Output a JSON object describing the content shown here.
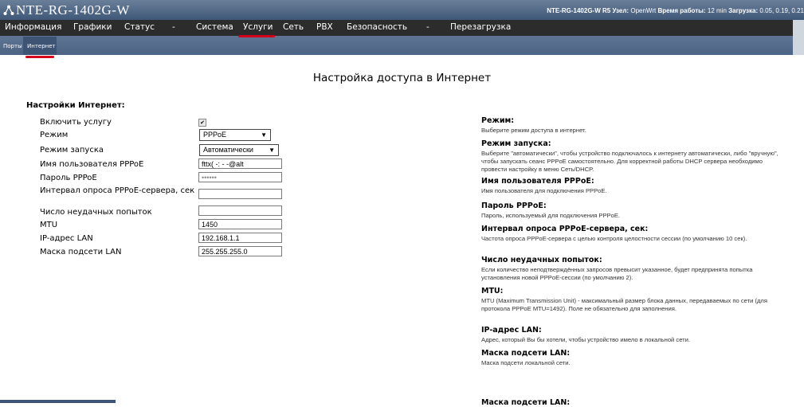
{
  "header": {
    "app_title": "NTE-RG-1402G-W",
    "status_model": "NTE-RG-1402G-W R5",
    "status_node_label": "Узел:",
    "status_node": "OpenWrt",
    "status_uptime_label": "Время работы:",
    "status_uptime": "12 min",
    "status_load_label": "Загрузка:",
    "status_load": "0.05, 0.19, 0.21"
  },
  "menu": {
    "items": [
      "Информация",
      "Графики",
      "Статус",
      "-",
      "Система",
      "Услуги",
      "Сеть",
      "PBX",
      "Безопасность",
      "-",
      "Перезагрузка"
    ],
    "active": "Услуги"
  },
  "submenu": {
    "items": [
      "Порты",
      "Интернет"
    ],
    "active": "Интернет"
  },
  "page": {
    "title": "Настройка доступа в Интернет",
    "section_title": "Настройки Интернет:"
  },
  "form": {
    "enable_label": "Включить услугу",
    "enable_checked": true,
    "mode_label": "Режим",
    "mode_value": "PPPoE",
    "start_label": "Режим запуска",
    "start_value": "Автоматически",
    "username_label": "Имя пользователя PPPoE",
    "username_value": "fttx(      -:      -      -@alt",
    "password_label": "Пароль PPPoE",
    "password_value": "••••••",
    "interval_label": "Интервал опроса PPPoE-сервера, сек",
    "interval_value": "",
    "failures_label": "Число неудачных попыток",
    "failures_value": "",
    "mtu_label": "MTU",
    "mtu_value": "1450",
    "ip_label": "IP-адрес LAN",
    "ip_value": "192.168.1.1",
    "mask_label": "Маска подсети LAN",
    "mask_value": "255.255.255.0"
  },
  "help": [
    {
      "title": "Режим:",
      "text": "Выберите режим доступа в интернет."
    },
    {
      "title": "Режим запуска:",
      "text": "Выберите \"автоматически\", чтобы устройство подключалось к интернету автоматически, либо \"вручную\", чтобы запускать сеанс PPPoE самостоятельно. Для корректной работы DHCP сервера необходимо провести настройку в меню Сеть/DHCP."
    },
    {
      "title": "Имя пользователя PPPoE:",
      "text": "Имя пользователя для подключения PPPoE."
    },
    {
      "title": "Пароль PPPoE:",
      "text": "Пароль, используемый для подключения PPPoE."
    },
    {
      "title": "Интервал опроса PPPoE-сервера, сек:",
      "text": "Частота опроса PPPoE-сервера с целью контроля целостности сессии (по умолчанию 10 сек)."
    },
    {
      "title": "Число неудачных попыток:",
      "text": "Если количество неподтверждённых запросов превысит указанное, будет предпринята попытка установления новой PPPoE-сессии (по умолчанию 2)."
    },
    {
      "title": "MTU:",
      "text": "MTU (Maximum Transmission Unit) - максимальный размер блока данных, передаваемых по сети (для протокола PPPoE MTU=1492). Поле не обязательно для заполнения."
    },
    {
      "title": "IP-адрес LAN:",
      "text": "Адрес, который Вы бы хотели, чтобы устройство имело в локальной сети."
    },
    {
      "title": "Маска подсети LAN:",
      "text": "Маска подсети локальной сети."
    }
  ],
  "footer_cut_text": "Маска подсети LAN:",
  "colors": {
    "active_indicator": "#d6001c",
    "menubar": "#2c2c2c",
    "header": "#4b6384"
  }
}
